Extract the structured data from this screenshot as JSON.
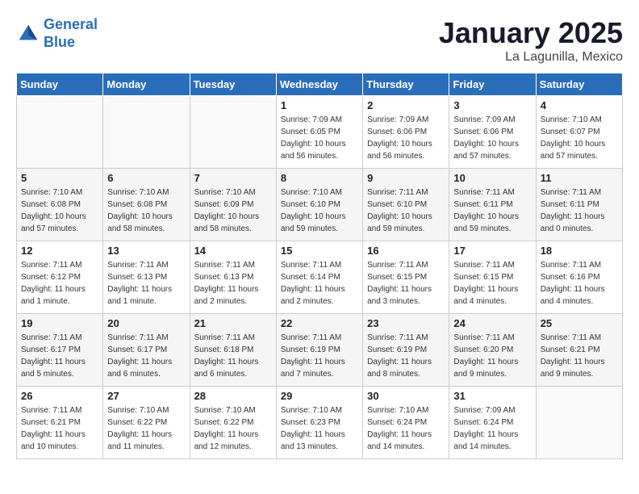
{
  "header": {
    "logo_line1": "General",
    "logo_line2": "Blue",
    "month": "January 2025",
    "location": "La Lagunilla, Mexico"
  },
  "days_of_week": [
    "Sunday",
    "Monday",
    "Tuesday",
    "Wednesday",
    "Thursday",
    "Friday",
    "Saturday"
  ],
  "weeks": [
    [
      {
        "day": "",
        "info": ""
      },
      {
        "day": "",
        "info": ""
      },
      {
        "day": "",
        "info": ""
      },
      {
        "day": "1",
        "info": "Sunrise: 7:09 AM\nSunset: 6:05 PM\nDaylight: 10 hours\nand 56 minutes."
      },
      {
        "day": "2",
        "info": "Sunrise: 7:09 AM\nSunset: 6:06 PM\nDaylight: 10 hours\nand 56 minutes."
      },
      {
        "day": "3",
        "info": "Sunrise: 7:09 AM\nSunset: 6:06 PM\nDaylight: 10 hours\nand 57 minutes."
      },
      {
        "day": "4",
        "info": "Sunrise: 7:10 AM\nSunset: 6:07 PM\nDaylight: 10 hours\nand 57 minutes."
      }
    ],
    [
      {
        "day": "5",
        "info": "Sunrise: 7:10 AM\nSunset: 6:08 PM\nDaylight: 10 hours\nand 57 minutes."
      },
      {
        "day": "6",
        "info": "Sunrise: 7:10 AM\nSunset: 6:08 PM\nDaylight: 10 hours\nand 58 minutes."
      },
      {
        "day": "7",
        "info": "Sunrise: 7:10 AM\nSunset: 6:09 PM\nDaylight: 10 hours\nand 58 minutes."
      },
      {
        "day": "8",
        "info": "Sunrise: 7:10 AM\nSunset: 6:10 PM\nDaylight: 10 hours\nand 59 minutes."
      },
      {
        "day": "9",
        "info": "Sunrise: 7:11 AM\nSunset: 6:10 PM\nDaylight: 10 hours\nand 59 minutes."
      },
      {
        "day": "10",
        "info": "Sunrise: 7:11 AM\nSunset: 6:11 PM\nDaylight: 10 hours\nand 59 minutes."
      },
      {
        "day": "11",
        "info": "Sunrise: 7:11 AM\nSunset: 6:11 PM\nDaylight: 11 hours\nand 0 minutes."
      }
    ],
    [
      {
        "day": "12",
        "info": "Sunrise: 7:11 AM\nSunset: 6:12 PM\nDaylight: 11 hours\nand 1 minute."
      },
      {
        "day": "13",
        "info": "Sunrise: 7:11 AM\nSunset: 6:13 PM\nDaylight: 11 hours\nand 1 minute."
      },
      {
        "day": "14",
        "info": "Sunrise: 7:11 AM\nSunset: 6:13 PM\nDaylight: 11 hours\nand 2 minutes."
      },
      {
        "day": "15",
        "info": "Sunrise: 7:11 AM\nSunset: 6:14 PM\nDaylight: 11 hours\nand 2 minutes."
      },
      {
        "day": "16",
        "info": "Sunrise: 7:11 AM\nSunset: 6:15 PM\nDaylight: 11 hours\nand 3 minutes."
      },
      {
        "day": "17",
        "info": "Sunrise: 7:11 AM\nSunset: 6:15 PM\nDaylight: 11 hours\nand 4 minutes."
      },
      {
        "day": "18",
        "info": "Sunrise: 7:11 AM\nSunset: 6:16 PM\nDaylight: 11 hours\nand 4 minutes."
      }
    ],
    [
      {
        "day": "19",
        "info": "Sunrise: 7:11 AM\nSunset: 6:17 PM\nDaylight: 11 hours\nand 5 minutes."
      },
      {
        "day": "20",
        "info": "Sunrise: 7:11 AM\nSunset: 6:17 PM\nDaylight: 11 hours\nand 6 minutes."
      },
      {
        "day": "21",
        "info": "Sunrise: 7:11 AM\nSunset: 6:18 PM\nDaylight: 11 hours\nand 6 minutes."
      },
      {
        "day": "22",
        "info": "Sunrise: 7:11 AM\nSunset: 6:19 PM\nDaylight: 11 hours\nand 7 minutes."
      },
      {
        "day": "23",
        "info": "Sunrise: 7:11 AM\nSunset: 6:19 PM\nDaylight: 11 hours\nand 8 minutes."
      },
      {
        "day": "24",
        "info": "Sunrise: 7:11 AM\nSunset: 6:20 PM\nDaylight: 11 hours\nand 9 minutes."
      },
      {
        "day": "25",
        "info": "Sunrise: 7:11 AM\nSunset: 6:21 PM\nDaylight: 11 hours\nand 9 minutes."
      }
    ],
    [
      {
        "day": "26",
        "info": "Sunrise: 7:11 AM\nSunset: 6:21 PM\nDaylight: 11 hours\nand 10 minutes."
      },
      {
        "day": "27",
        "info": "Sunrise: 7:10 AM\nSunset: 6:22 PM\nDaylight: 11 hours\nand 11 minutes."
      },
      {
        "day": "28",
        "info": "Sunrise: 7:10 AM\nSunset: 6:22 PM\nDaylight: 11 hours\nand 12 minutes."
      },
      {
        "day": "29",
        "info": "Sunrise: 7:10 AM\nSunset: 6:23 PM\nDaylight: 11 hours\nand 13 minutes."
      },
      {
        "day": "30",
        "info": "Sunrise: 7:10 AM\nSunset: 6:24 PM\nDaylight: 11 hours\nand 14 minutes."
      },
      {
        "day": "31",
        "info": "Sunrise: 7:09 AM\nSunset: 6:24 PM\nDaylight: 11 hours\nand 14 minutes."
      },
      {
        "day": "",
        "info": ""
      }
    ]
  ]
}
